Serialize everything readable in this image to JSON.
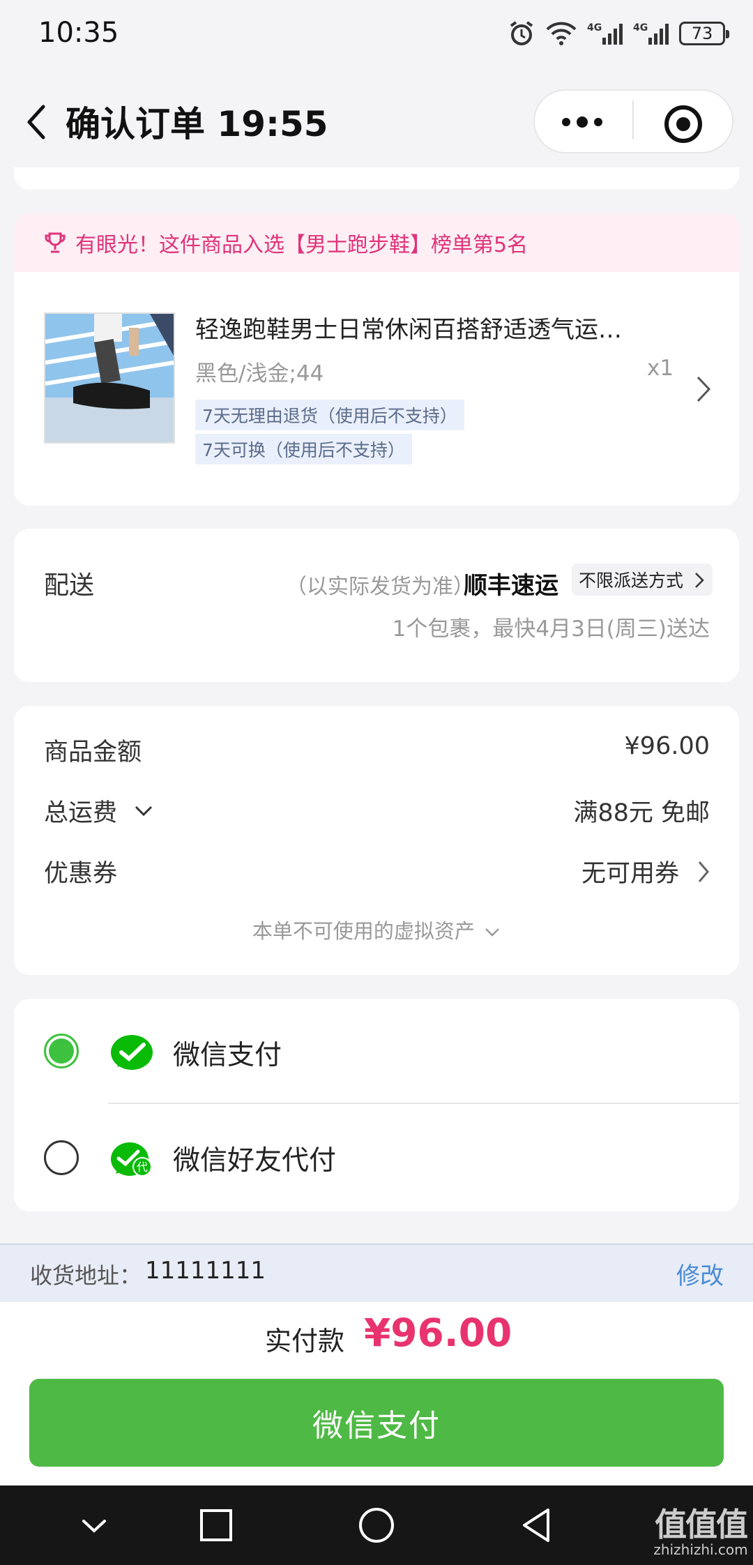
{
  "status_bar": {
    "time": "10:35",
    "battery": "73"
  },
  "nav": {
    "title": "确认订单 19:55"
  },
  "product": {
    "rank_banner": "有眼光！这件商品入选【男士跑步鞋】榜单第5名",
    "title": "轻逸跑鞋男士日常休闲百搭舒适透气运…",
    "variant": "黑色/浅金;44",
    "quantity": "x1",
    "tags": [
      "7天无理由退货（使用后不支持）",
      "7天可换（使用后不支持）"
    ]
  },
  "delivery": {
    "label": "配送",
    "note": "（以实际发货为准）",
    "carrier": "顺丰速运",
    "mode": "不限派送方式",
    "eta": "1个包裹，最快4月3日(周三)送达"
  },
  "costs": {
    "goods_label": "商品金额",
    "goods_value": "¥96.00",
    "shipping_label": "总运费",
    "shipping_value": "满88元 免邮",
    "coupon_label": "优惠券",
    "coupon_value": "无可用券",
    "virtual_assets": "本单不可使用的虚拟资产"
  },
  "payment": {
    "options": [
      {
        "label": "微信支付",
        "selected": true
      },
      {
        "label": "微信好友代付",
        "selected": false
      }
    ],
    "friend_badge": "代"
  },
  "address": {
    "label": "收货地址：",
    "value": "11111111",
    "edit": "修改"
  },
  "footer": {
    "total_label": "实付款",
    "total_value": "¥96.00",
    "pay_button": "微信支付"
  },
  "watermark": {
    "big": "值值值",
    "small": "zhizhizhi.com"
  },
  "colors": {
    "accent_green": "#4fb946",
    "price_pink": "#e8336f",
    "link_blue": "#4a8bd6",
    "rank_pink": "#e0337a"
  }
}
